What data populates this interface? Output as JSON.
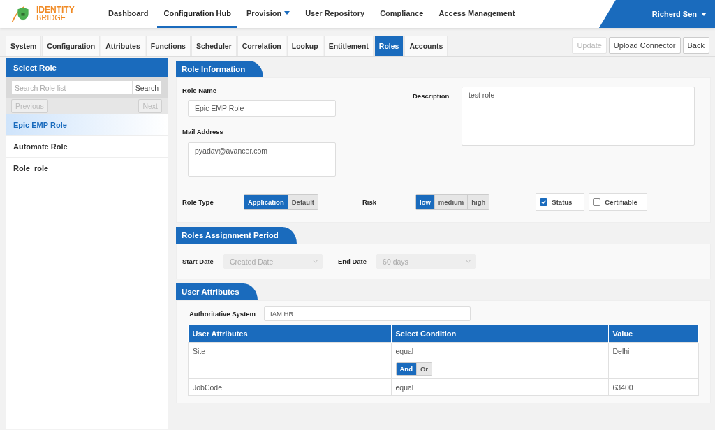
{
  "header": {
    "logo": {
      "line1": "IDENTITY",
      "line2": "BRIDGE"
    },
    "nav": [
      {
        "label": "Dashboard",
        "selected": false,
        "dropdown": false
      },
      {
        "label": "Configuration Hub",
        "selected": true,
        "dropdown": false
      },
      {
        "label": "Provision",
        "selected": false,
        "dropdown": true
      },
      {
        "label": "User Repository",
        "selected": false,
        "dropdown": false
      },
      {
        "label": "Compliance",
        "selected": false,
        "dropdown": false
      },
      {
        "label": "Access Management",
        "selected": false,
        "dropdown": false
      }
    ],
    "user": {
      "name": "Richerd Sen"
    }
  },
  "tabs": [
    {
      "label": "System",
      "selected": false
    },
    {
      "label": "Configuration",
      "selected": false
    },
    {
      "label": "Attributes",
      "selected": false
    },
    {
      "label": "Functions",
      "selected": false
    },
    {
      "label": "Scheduler",
      "selected": false
    },
    {
      "label": "Correlation",
      "selected": false
    },
    {
      "label": "Lookup",
      "selected": false
    },
    {
      "label": "Entitlement",
      "selected": false
    },
    {
      "label": "Roles",
      "selected": true
    },
    {
      "label": "Accounts",
      "selected": false
    }
  ],
  "actions": [
    {
      "label": "Update",
      "disabled": true
    },
    {
      "label": "Upload Connector",
      "disabled": false
    },
    {
      "label": "Back",
      "disabled": false
    }
  ],
  "sidebar": {
    "title": "Select Role",
    "search": {
      "placeholder": "Search Role list",
      "button": "Search"
    },
    "pager": [
      {
        "label": "Previous",
        "disabled": true
      },
      {
        "label": "Next",
        "disabled": true
      }
    ],
    "items": [
      {
        "label": "Epic EMP Role",
        "selected": true
      },
      {
        "label": "Automate Role",
        "selected": false
      },
      {
        "label": "Role_role",
        "selected": false
      }
    ]
  },
  "role_information": {
    "title": "Role Information",
    "role_name": {
      "label": "Role Name",
      "value": "Epic EMP Role"
    },
    "mail_address": {
      "label": "Mail Address",
      "value": "pyadav@avancer.com"
    },
    "description": {
      "label": "Description",
      "value": "test role"
    },
    "role_type": {
      "label": "Role Type",
      "options": [
        {
          "label": "Application",
          "selected": true
        },
        {
          "label": "Default",
          "selected": false
        }
      ]
    },
    "risk": {
      "label": "Risk",
      "options": [
        {
          "label": "low",
          "selected": true
        },
        {
          "label": "medium",
          "selected": false
        },
        {
          "label": "high",
          "selected": false
        }
      ]
    },
    "checkboxes": [
      {
        "label": "Status",
        "checked": true
      },
      {
        "label": "Certifiable",
        "checked": false
      }
    ]
  },
  "assignment_period": {
    "title": "Roles Assignment Period",
    "start_date": {
      "label": "Start Date",
      "value": "Created Date",
      "disabled": true
    },
    "end_date": {
      "label": "End Date",
      "value": "60 days",
      "disabled": true
    }
  },
  "user_attributes": {
    "title": "User Attributes",
    "authoritative_system": {
      "label": "Authoritative System",
      "value": "IAM HR"
    },
    "columns": [
      "User Attributes",
      "Select Condition",
      "Value"
    ],
    "rows": [
      {
        "kind": "data",
        "cells": [
          "Site",
          "equal",
          "Delhi"
        ]
      },
      {
        "kind": "operator",
        "options": [
          {
            "label": "And",
            "selected": true
          },
          {
            "label": "Or",
            "selected": false
          }
        ]
      },
      {
        "kind": "data",
        "cells": [
          "JobCode",
          "equal",
          "63400"
        ]
      }
    ]
  }
}
